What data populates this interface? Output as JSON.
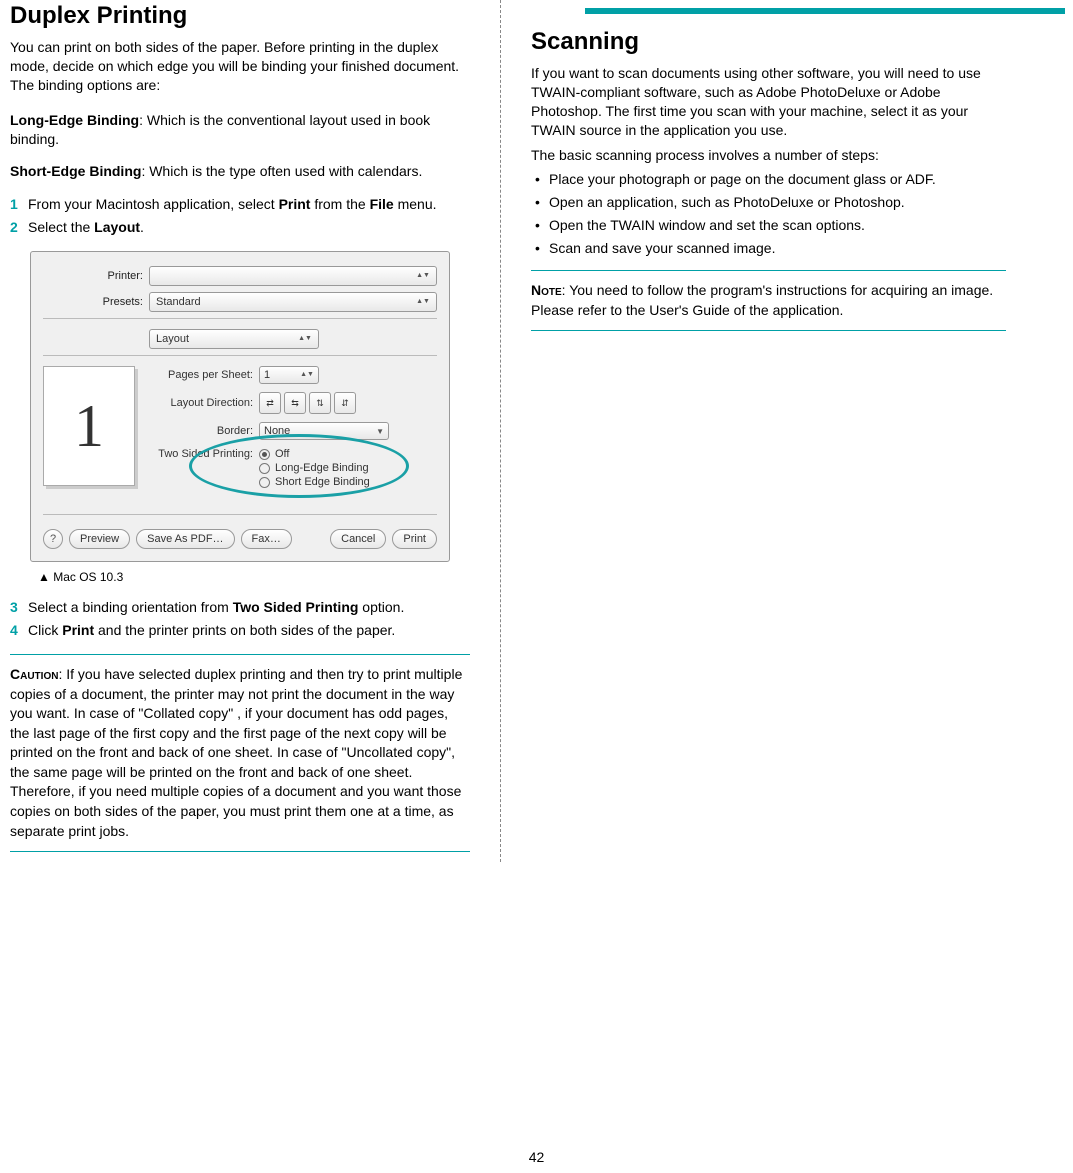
{
  "page_number": "42",
  "left": {
    "heading": "Duplex Printing",
    "intro": "You can print on both sides of the paper. Before printing in the duplex mode, decide on which edge you will be binding your finished document. The binding options are:",
    "long_edge_label": "Long-Edge Binding",
    "long_edge_text": ": Which is the conventional layout used in book binding.",
    "short_edge_label": "Short-Edge Binding",
    "short_edge_text": ": Which is the type often used with calendars.",
    "steps_a": {
      "s1_num": "1",
      "s1_a": "From your Macintosh application, select ",
      "s1_b": "Print",
      "s1_c": " from the ",
      "s1_d": "File",
      "s1_e": " menu.",
      "s2_num": "2",
      "s2_a": "Select the ",
      "s2_b": "Layout",
      "s2_c": "."
    },
    "caption": "▲ Mac OS 10.3",
    "steps_b": {
      "s3_num": "3",
      "s3_a": "Select a binding orientation from ",
      "s3_b": "Two Sided Printing",
      "s3_c": " option.",
      "s4_num": "4",
      "s4_a": "Click ",
      "s4_b": "Print",
      "s4_c": " and the printer prints on both sides of the paper."
    },
    "caution_label": "Caution",
    "caution_text": ": If you have selected duplex printing and then try to print multiple copies of a document, the printer may not print the document in the way you want. In case of  \"Collated copy\" , if your document has odd pages, the last page of the first copy and the first page of the next copy will be printed on the front and back of one sheet. In case of  \"Uncollated copy\", the same page will be printed on the front and back of one sheet. Therefore, if you need multiple copies of a document and you want those copies on both sides of the paper, you must print them one at a time, as separate print jobs."
  },
  "dialog": {
    "printer_label": "Printer:",
    "printer_value": "",
    "presets_label": "Presets:",
    "presets_value": "Standard",
    "section_value": "Layout",
    "pps_label": "Pages per Sheet:",
    "pps_value": "1",
    "dir_label": "Layout Direction:",
    "border_label": "Border:",
    "border_value": "None",
    "two_sided_label": "Two Sided Printing:",
    "radio_off": "Off",
    "radio_long": "Long-Edge Binding",
    "radio_short": "Short Edge Binding",
    "preview_page": "1",
    "help": "?",
    "btn_preview": "Preview",
    "btn_pdf": "Save As PDF…",
    "btn_fax": "Fax…",
    "btn_cancel": "Cancel",
    "btn_print": "Print"
  },
  "right": {
    "heading": "Scanning",
    "p1": "If you want to scan documents using other software, you will need to use TWAIN-compliant software, such as Adobe PhotoDeluxe or Adobe Photoshop. The first time you scan with your machine, select it as your TWAIN source in the application you use.",
    "p2": "The basic scanning process involves a number of steps:",
    "bullets": [
      "Place your photograph or page on the document glass or ADF.",
      "Open an application, such as PhotoDeluxe or Photoshop.",
      "Open the TWAIN window and set the scan options.",
      "Scan and save your scanned image."
    ],
    "note_label": "Note",
    "note_text": ": You need to follow the program's instructions for acquiring an image. Please refer to the User's Guide of the application."
  }
}
